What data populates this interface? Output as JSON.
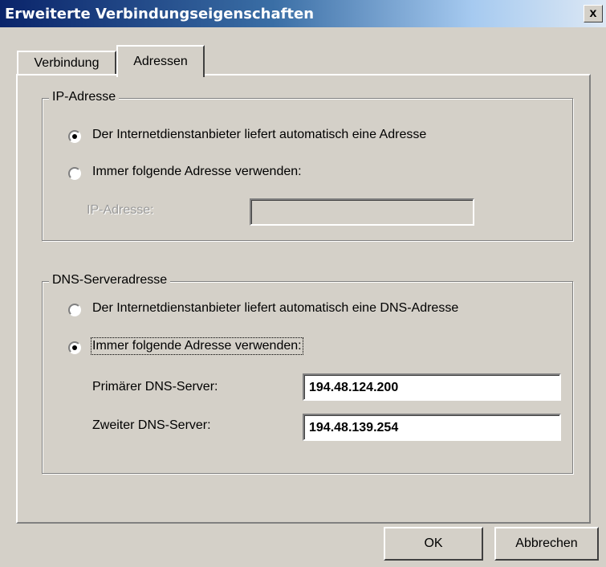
{
  "window": {
    "title": "Erweiterte Verbindungseigenschaften",
    "close_label": "x"
  },
  "tabs": [
    {
      "label": "Verbindung",
      "selected": false
    },
    {
      "label": "Adressen",
      "selected": true
    }
  ],
  "ip_group": {
    "label": "IP-Adresse",
    "option_auto": {
      "label": "Der Internetdienstanbieter liefert automatisch eine Adresse",
      "checked": true
    },
    "option_manual": {
      "label": "Immer folgende Adresse verwenden:",
      "checked": false
    },
    "ip_field": {
      "label": "IP-Adresse:",
      "value": "",
      "disabled": true
    }
  },
  "dns_group": {
    "label": "DNS-Serveradresse",
    "option_auto": {
      "label": "Der Internetdienstanbieter liefert automatisch eine DNS-Adresse",
      "checked": false
    },
    "option_manual": {
      "label": "Immer folgende Adresse verwenden:",
      "checked": true
    },
    "primary": {
      "label": "Primärer DNS-Server:",
      "value": "194.48.124.200"
    },
    "secondary": {
      "label": "Zweiter DNS-Server:",
      "value": "194.48.139.254"
    }
  },
  "buttons": {
    "ok": "OK",
    "cancel": "Abbrechen"
  }
}
